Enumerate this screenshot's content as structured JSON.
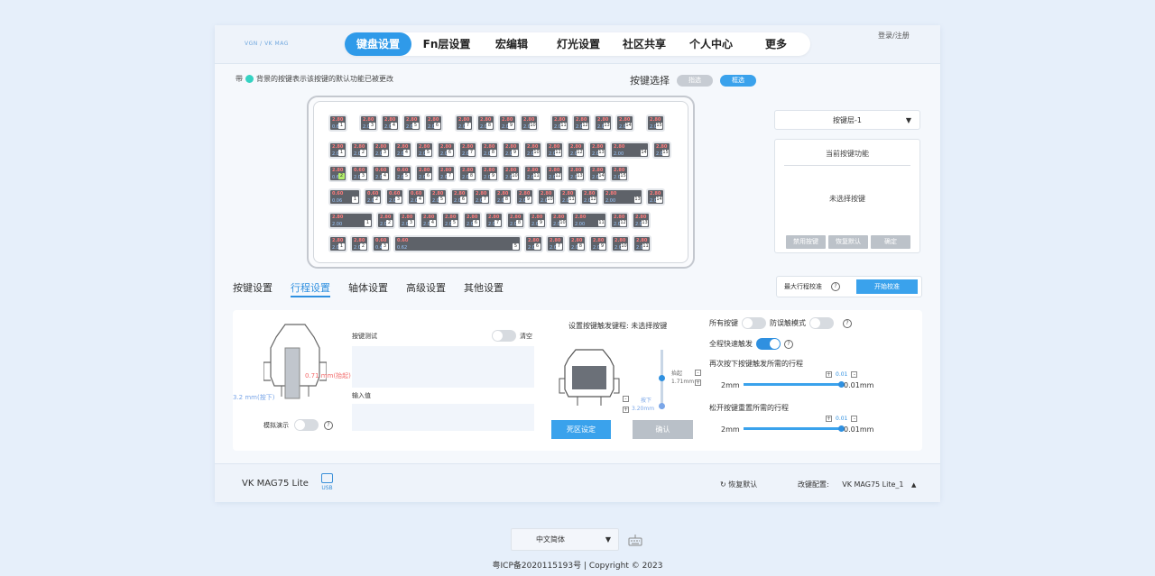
{
  "header": {
    "logo_text": "VGN / VK MAG",
    "nav": [
      "键盘设置",
      "Fn层设置",
      "宏编辑",
      "灯光设置",
      "社区共享",
      "个人中心",
      "更多"
    ],
    "active_nav": "键盘设置",
    "login": "登录/注册"
  },
  "notice": {
    "prefix": "带",
    "text": "背景的按键表示该按键的默认功能已被更改"
  },
  "key_select": {
    "label": "按键选择",
    "option_point": "指选",
    "option_box": "框选",
    "active": "框选"
  },
  "keyboard": {
    "rows": [
      [
        [
          "2.80",
          "0.60",
          "1"
        ],
        [
          "2.80",
          "2.00",
          "3"
        ],
        [
          "2.80",
          "2.00",
          "4"
        ],
        [
          "2.80",
          "2.00",
          "5"
        ],
        [
          "2.80",
          "2.00",
          "6"
        ],
        [
          "2.80",
          "2.00",
          "7"
        ],
        [
          "2.80",
          "2.00",
          "8"
        ],
        [
          "2.80",
          "2.00",
          "9"
        ],
        [
          "2.80",
          "2.00",
          "10"
        ],
        [
          "2.80",
          "2.00",
          "11"
        ],
        [
          "2.80",
          "2.00",
          "12"
        ],
        [
          "2.80",
          "2.00",
          "13"
        ],
        [
          "2.80",
          "2.00",
          "14"
        ],
        [
          "2.80",
          "2.00",
          "15"
        ]
      ],
      [
        [
          "2.80",
          "2.00",
          "1"
        ],
        [
          "2.80",
          "2.00",
          "2"
        ],
        [
          "2.80",
          "2.00",
          "3"
        ],
        [
          "2.80",
          "2.00",
          "4"
        ],
        [
          "2.80",
          "2.00",
          "5"
        ],
        [
          "2.80",
          "2.00",
          "6"
        ],
        [
          "2.80",
          "2.00",
          "7"
        ],
        [
          "2.80",
          "2.00",
          "8"
        ],
        [
          "2.80",
          "2.00",
          "9"
        ],
        [
          "2.80",
          "2.00",
          "10"
        ],
        [
          "2.80",
          "2.00",
          "11"
        ],
        [
          "2.80",
          "2.00",
          "12"
        ],
        [
          "2.80",
          "2.00",
          "13"
        ],
        [
          "2.80",
          "2.00",
          "14"
        ],
        [
          "2.80",
          "2.00",
          "15"
        ]
      ],
      [
        [
          "2.80",
          "0.60",
          "2"
        ],
        [
          "0.60",
          "2.00",
          "3"
        ],
        [
          "0.60",
          "2.00",
          "4"
        ],
        [
          "0.60",
          "2.00",
          "5"
        ],
        [
          "2.80",
          "2.00",
          "6"
        ],
        [
          "2.80",
          "2.00",
          "7"
        ],
        [
          "2.80",
          "2.00",
          "8"
        ],
        [
          "2.80",
          "2.00",
          "9"
        ],
        [
          "2.80",
          "2.00",
          "10"
        ],
        [
          "2.80",
          "2.00",
          "11"
        ],
        [
          "2.80",
          "2.00",
          "12"
        ],
        [
          "2.80",
          "2.00",
          "13"
        ],
        [
          "2.80",
          "2.00",
          "14"
        ],
        [
          "2.80",
          "2.00",
          "15"
        ]
      ],
      [
        [
          "0.60",
          "0.06",
          "1"
        ],
        [
          "0.60",
          "2.00",
          "2"
        ],
        [
          "0.60",
          "2.00",
          "3"
        ],
        [
          "0.60",
          "2.00",
          "4"
        ],
        [
          "2.80",
          "2.00",
          "5"
        ],
        [
          "2.80",
          "2.00",
          "6"
        ],
        [
          "2.80",
          "2.00",
          "7"
        ],
        [
          "2.80",
          "2.00",
          "8"
        ],
        [
          "2.80",
          "2.00",
          "9"
        ],
        [
          "2.80",
          "2.00",
          "10"
        ],
        [
          "2.80",
          "2.00",
          "11"
        ],
        [
          "2.80",
          "2.00",
          "12"
        ],
        [
          "2.80",
          "2.00",
          "13"
        ],
        [
          "2.80",
          "2.00",
          "14"
        ]
      ],
      [
        [
          "2.80",
          "2.00",
          "1"
        ],
        [
          "2.80",
          "2.00",
          "2"
        ],
        [
          "2.80",
          "2.00",
          "3"
        ],
        [
          "2.80",
          "2.00",
          "4"
        ],
        [
          "2.80",
          "2.00",
          "5"
        ],
        [
          "2.80",
          "2.00",
          "6"
        ],
        [
          "2.80",
          "2.00",
          "7"
        ],
        [
          "2.80",
          "2.00",
          "8"
        ],
        [
          "2.80",
          "2.00",
          "9"
        ],
        [
          "2.80",
          "2.00",
          "10"
        ],
        [
          "2.80",
          "2.00",
          "11"
        ],
        [
          "2.80",
          "2.00",
          "12"
        ],
        [
          "2.80",
          "2.00",
          "13"
        ]
      ],
      [
        [
          "2.80",
          "2.00",
          "1"
        ],
        [
          "2.80",
          "2.00",
          "2"
        ],
        [
          "0.60",
          "0.40",
          "3"
        ],
        [
          "0.60",
          "0.62",
          "5"
        ],
        [
          "2.80",
          "2.00",
          "6"
        ],
        [
          "2.80",
          "2.00",
          "7"
        ],
        [
          "2.80",
          "2.00",
          "8"
        ],
        [
          "2.80",
          "2.00",
          "9"
        ],
        [
          "2.80",
          "2.00",
          "10"
        ],
        [
          "2.80",
          "2.00",
          "11"
        ]
      ]
    ],
    "green_key_labels": [
      "2",
      "3",
      "4"
    ]
  },
  "layer": {
    "selected": "按键层-1"
  },
  "current_func": {
    "title": "当前按键功能",
    "empty": "未选择按键",
    "buttons": [
      "禁用按键",
      "恢复默认",
      "确定"
    ]
  },
  "tabs": [
    "按键设置",
    "行程设置",
    "轴体设置",
    "高级设置",
    "其他设置"
  ],
  "active_tab": "行程设置",
  "calibration": {
    "label": "最大行程校准",
    "button": "开始校准"
  },
  "travel": {
    "red_mark": "0.71 mm(抬起)",
    "blue_mark": "3.2 mm(按下)",
    "sim_label": "模拟演示",
    "key_test": "按键测试",
    "clear": "清空",
    "input_label": "输入值",
    "trigger_title": "设置按键触发键程: 未选择按键",
    "lift_label": "抬起",
    "lift_val": "1.71mm",
    "press_label": "按下",
    "press_val": "3.20mm",
    "dead_zone": "死区设定",
    "confirm": "确认"
  },
  "right_settings": {
    "all_keys": "所有按键",
    "anti_mis": "防误触模式",
    "full_rapid": "全程快速触发",
    "repress_label": "再次按下按键触发所需的行程",
    "release_label": "松开按键重置所需的行程",
    "min": "2mm",
    "step": "0.01",
    "value": "0.01mm"
  },
  "footer": {
    "model": "VK MAG75 Lite",
    "usb": "USB",
    "restore": "恢复默认",
    "cfg_label": "改键配置:",
    "cfg_value": "VK MAG75 Lite_1"
  },
  "bottom": {
    "language": "中文简体",
    "copyright": "粤ICP备2020115193号 | Copyright © 2023"
  },
  "colors": {
    "accent": "#2f9ae9",
    "background": "#e6effa",
    "key": "#5e6269"
  }
}
